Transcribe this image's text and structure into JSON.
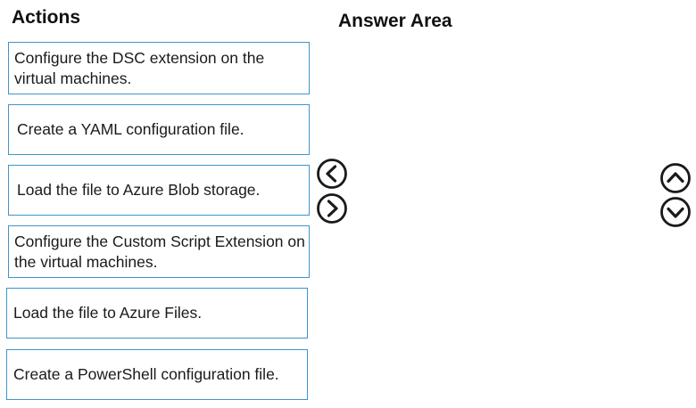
{
  "actions_panel": {
    "heading": "Actions",
    "items": [
      {
        "text": "Configure the DSC extension on the virtual machines."
      },
      {
        "text": "Create a YAML configuration file."
      },
      {
        "text": "Load the file to Azure Blob storage."
      },
      {
        "text": "Configure the Custom Script Extension on the virtual machines."
      },
      {
        "text": "Load the file to Azure Files."
      },
      {
        "text": "Create a PowerShell configuration file."
      }
    ]
  },
  "answer_panel": {
    "heading": "Answer Area",
    "items": []
  },
  "controls": {
    "move_left_icon": "chevron-left-circle-icon",
    "move_right_icon": "chevron-right-circle-icon",
    "move_up_icon": "chevron-up-circle-icon",
    "move_down_icon": "chevron-down-circle-icon"
  },
  "colors": {
    "box_border": "#3f95c9",
    "text": "#1a1a1a",
    "heading": "#111111",
    "icon": "#1a1a1a"
  }
}
